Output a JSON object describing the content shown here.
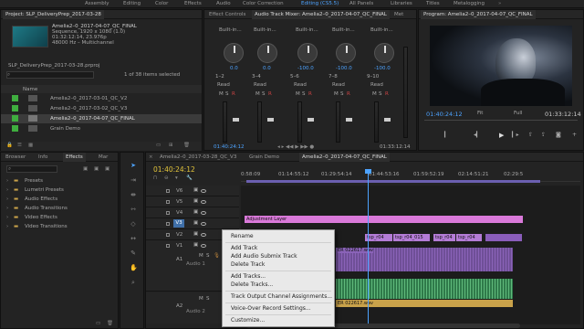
{
  "workspaces": [
    "Assembly",
    "Editing",
    "Color",
    "Effects",
    "Audio",
    "Color Correction",
    "Editing (CS5.5)",
    "All Panels",
    "Libraries",
    "Titles",
    "Metalogging"
  ],
  "active_workspace_index": 6,
  "project": {
    "tab": "Project: SLP_DeliveryPrep_2017-03-28",
    "clip_name": "Amelia2–0_2017-04-07_QC_FINAL",
    "clip_info1": "Sequence, 1920 x 1080 (1.0)",
    "clip_info2": "01:32:12:14, 23.976p",
    "clip_info3": "48000 Hz – Multichannel",
    "file": "SLP_DeliveryPrep_2017-03-28.prproj",
    "selected_count": "1 of 38 items selected",
    "col_name": "Name",
    "items": [
      "Amelia2–0_2017-03-01_QC_V2",
      "Amelia2–0_2017-03-02_QC_V3",
      "Amelia2–0_2017-04-07_QC_FINAL",
      "Grain Demo"
    ],
    "item_colors": [
      "#3fae3f",
      "#3fae3f",
      "#3fae3f",
      "#3fae3f"
    ]
  },
  "mixer": {
    "tab_effect_controls": "Effect Controls",
    "tab_mixer": "Audio Track Mixer: Amelia2–0_2017-04-07_QC_FINAL",
    "tab_meta": "Met",
    "channels": [
      {
        "label": "Built-in...",
        "pan": "0.0",
        "route": "1–2",
        "vol": "0.0",
        "mode": "Read"
      },
      {
        "label": "Built-in...",
        "pan": "0.0",
        "route": "3–4",
        "vol": "0.0",
        "mode": "Read"
      },
      {
        "label": "Built-in...",
        "pan": "-100.0",
        "route": "5–6",
        "vol": "-100.0",
        "mode": "Read"
      },
      {
        "label": "Built-in...",
        "pan": "-100.0",
        "route": "7–8",
        "vol": "-100.0",
        "mode": "Read"
      },
      {
        "label": "Built-in...",
        "pan": "-100.0",
        "route": "9–10",
        "vol": "-100.0",
        "mode": "Read"
      }
    ],
    "timecode_left": "01:40:24:12",
    "timecode_right": "01:33:12:14",
    "msr": [
      "M",
      "S",
      "R"
    ]
  },
  "program": {
    "tab": "Program: Amelia2–0_2017-04-07_QC_FINAL",
    "timecode": "01:40:24:12",
    "fit": "Fit",
    "quality": "Full",
    "duration": "01:33:12:14"
  },
  "effects": {
    "tabs": [
      "Browser",
      "Info",
      "Effects",
      "Mar"
    ],
    "search_placeholder": "",
    "folders": [
      "Presets",
      "Lumetri Presets",
      "Audio Effects",
      "Audio Transitions",
      "Video Effects",
      "Video Transitions"
    ]
  },
  "timeline": {
    "tabs": [
      "Amelia2–0_2017-03-28_QC_V3",
      "Grain Demo",
      "Amelia2–0_2017-04-07_QC_FINAL"
    ],
    "active_tab": 2,
    "timecode": "01:40:24:12",
    "ruler": [
      "0:58:09",
      "01:14:55:12",
      "01:29:54:14",
      "01:44:53:16",
      "01:59:52:19",
      "02:14:51:21",
      "02:29:5"
    ],
    "video_tracks": [
      "V6",
      "V5",
      "V4",
      "V3",
      "V2",
      "V1"
    ],
    "audio_labels": [
      "A1",
      "Audio 1",
      "A2",
      "Audio 2"
    ],
    "adjustment_layer": "Adjustment Layer",
    "clips_v1": [
      "tsp_r04",
      "tsp_r04_015",
      "tsp_r04",
      "tsp_r04"
    ],
    "audio_clip": "ER 022617.wav",
    "audio_clip2": "ER 022617.wav"
  },
  "context_menu": {
    "groups": [
      [
        "Rename"
      ],
      [
        "Add Track",
        "Add Audio Submix Track",
        "Delete Track"
      ],
      [
        "Add Tracks...",
        "Delete Tracks..."
      ],
      [
        "Track Output Channel Assignments..."
      ],
      [
        "Voice-Over Record Settings..."
      ],
      [
        "Customize..."
      ]
    ]
  },
  "colors": {
    "accent_blue": "#4da3ff",
    "timecode_yellow": "#e2c43b",
    "clip_purple": "#b47cd6",
    "clip_pink": "#d979d9",
    "audio_green": "#4fb26a",
    "playhead": "#4da3ff"
  }
}
